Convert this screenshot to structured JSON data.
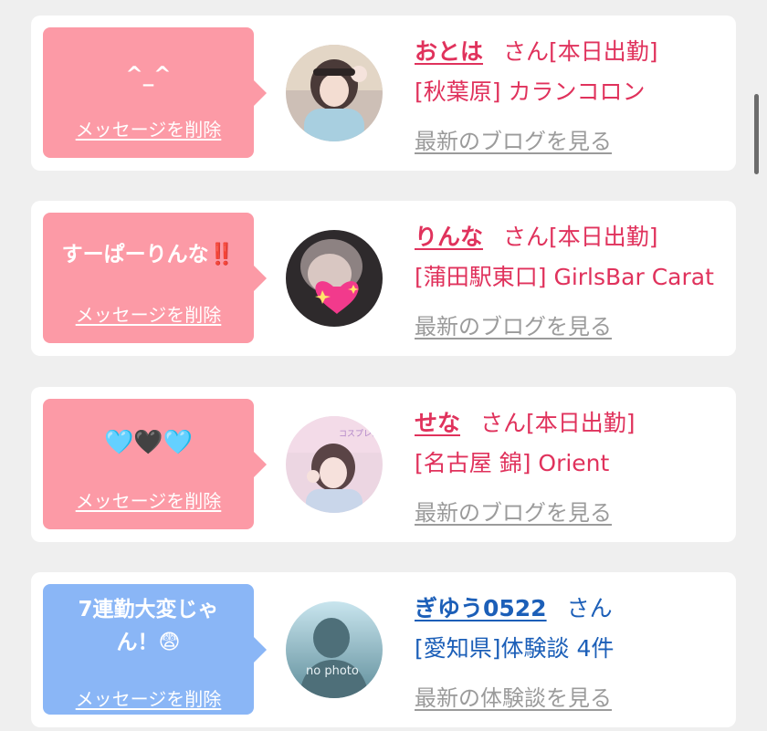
{
  "cards": [
    {
      "message": "^_^",
      "delete_label": "メッセージを削除",
      "name": "おとは",
      "suffix": "さん",
      "status": "[本日出勤]",
      "info": "[秋葉原] カランコロン",
      "more_label": "最新のブログを見る"
    },
    {
      "message": "すーぱーりんな",
      "message_emoji": "‼️",
      "delete_label": "メッセージを削除",
      "name": "りんな",
      "suffix": "さん",
      "status": "[本日出勤]",
      "info": "[蒲田駅東口] GirlsBar Carat",
      "more_label": "最新のブログを見る"
    },
    {
      "message": "🩵🖤🩵",
      "delete_label": "メッセージを削除",
      "name": "せな",
      "suffix": "さん",
      "status": "[本日出勤]",
      "info": "[名古屋 錦] Orient",
      "more_label": "最新のブログを見る",
      "avatar_overlay": "コスプレガールズ"
    },
    {
      "message": "7連勤大変じゃん！😨",
      "delete_label": "メッセージを削除",
      "name": "ぎゆう0522",
      "suffix": "さん",
      "info": "[愛知県]体験談 4件",
      "more_label": "最新の体験談を見る",
      "avatar_label": "no photo"
    }
  ],
  "colors": {
    "pink_bubble": "#fc9aa6",
    "blue_bubble": "#8ab6f6",
    "pink_text": "#e0325c",
    "blue_text": "#1c5fb8",
    "link_gray": "#9b9b9b"
  }
}
